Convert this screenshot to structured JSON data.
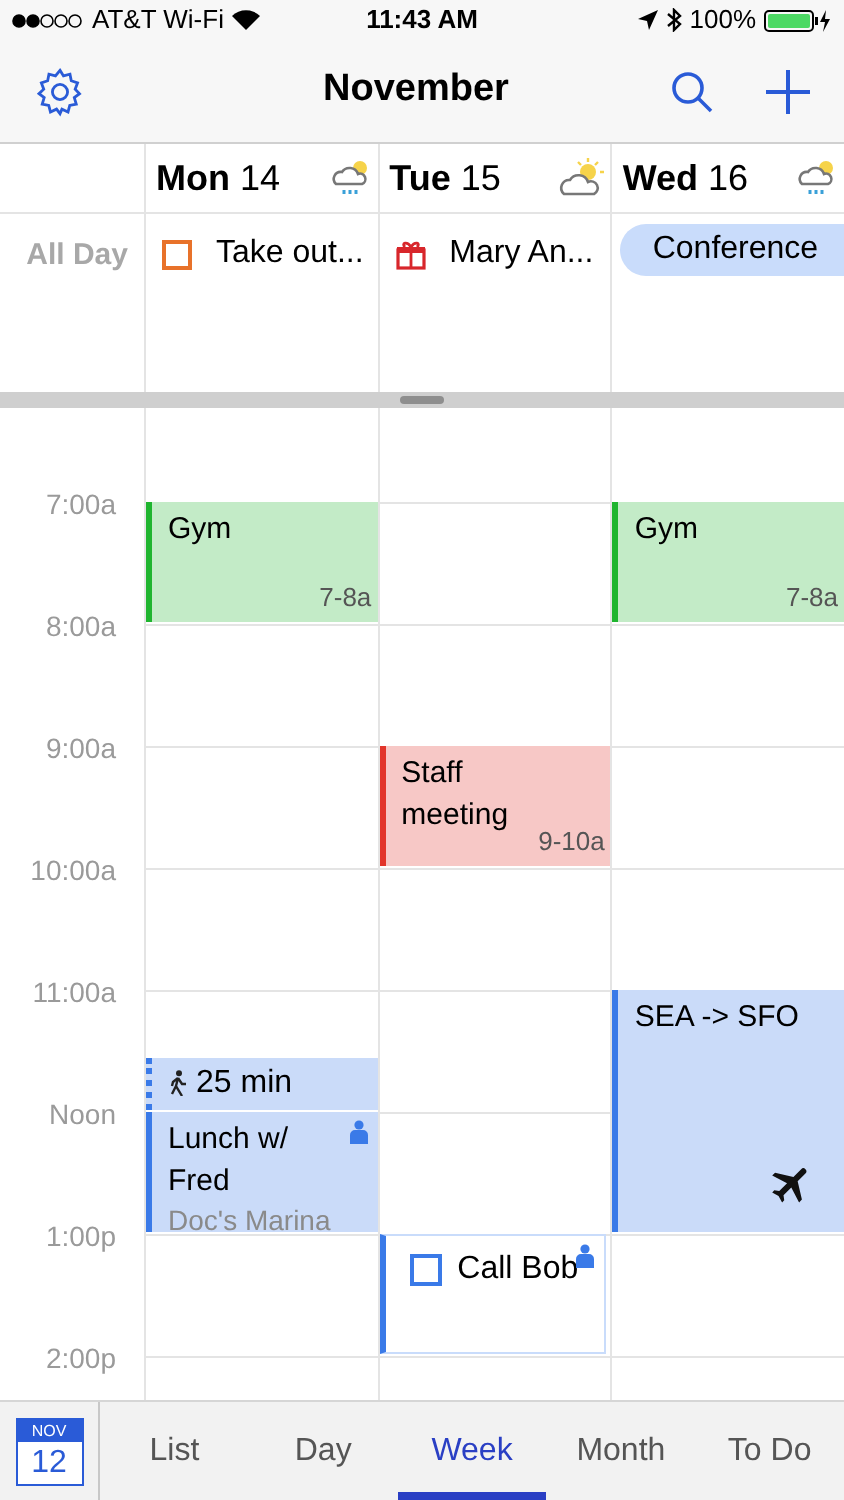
{
  "status_bar": {
    "carrier": "AT&T Wi-Fi",
    "time": "11:43 AM",
    "battery": "100%"
  },
  "header": {
    "title": "November"
  },
  "days": [
    {
      "label": "Mon",
      "date": "14",
      "weather": {
        "kind": "rain"
      },
      "all_day": {
        "kind": "task",
        "title": "Take out...",
        "color": "#e8722a"
      },
      "events": [
        {
          "kind": "event",
          "title": "Gym",
          "time": "7-8a",
          "color": "#1fb52f"
        },
        {
          "kind": "travel",
          "title": "25 min",
          "color": "#3a7ae8"
        },
        {
          "kind": "event",
          "title": "Lunch w/ Fred",
          "location": "Doc's Marina",
          "shared": true,
          "color": "#3a7ae8"
        }
      ]
    },
    {
      "label": "Tue",
      "date": "15",
      "weather": {
        "kind": "sun"
      },
      "all_day": {
        "kind": "birthday",
        "title": "Mary An...",
        "color": "#d8262b"
      },
      "events": [
        {
          "kind": "event",
          "title": "Staff meeting",
          "time": "9-10a",
          "color": "#e2352b"
        },
        {
          "kind": "task",
          "title": "Call Bob",
          "shared": true,
          "checked": false,
          "color": "#3a7ae8"
        }
      ]
    },
    {
      "label": "Wed",
      "date": "16",
      "weather": {
        "kind": "rain"
      },
      "all_day": {
        "kind": "event",
        "title": "Conference",
        "color": "#c9dcfb"
      },
      "events": [
        {
          "kind": "event",
          "title": "Gym",
          "time": "7-8a",
          "color": "#1fb52f"
        },
        {
          "kind": "flight",
          "title": "SEA -> SFO",
          "color": "#3a7ae8"
        }
      ]
    }
  ],
  "all_day_label": "All Day",
  "hours": [
    "7:00a",
    "8:00a",
    "9:00a",
    "10:00a",
    "11:00a",
    "Noon",
    "1:00p",
    "2:00p"
  ],
  "today_badge": {
    "month": "NOV",
    "day": "12"
  },
  "tabs": [
    {
      "label": "List",
      "selected": false
    },
    {
      "label": "Day",
      "selected": false
    },
    {
      "label": "Week",
      "selected": true
    },
    {
      "label": "Month",
      "selected": false
    },
    {
      "label": "To Do",
      "selected": false
    }
  ]
}
